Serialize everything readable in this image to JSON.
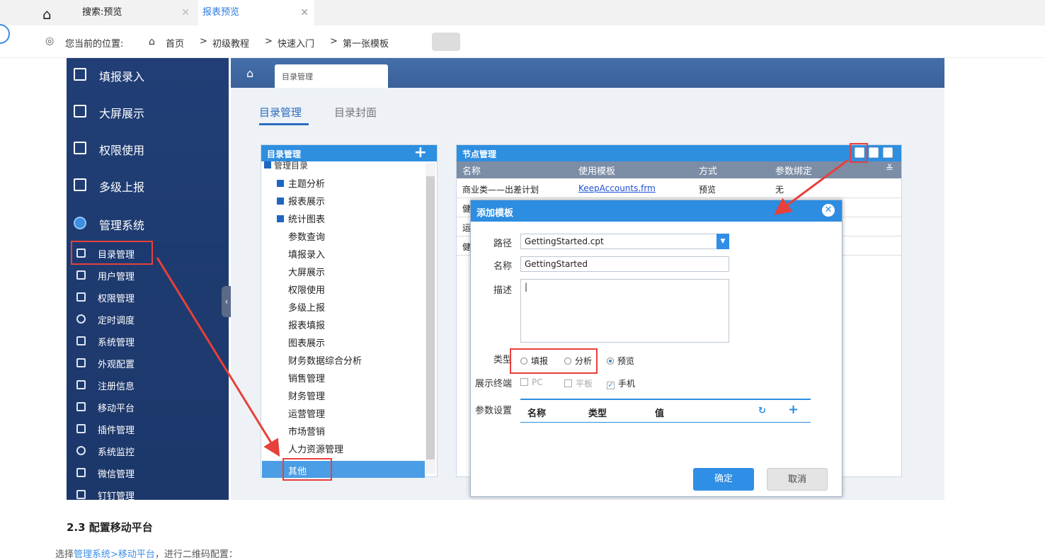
{
  "tabs": {
    "home_icon": "home-icon",
    "tab1_label": "搜索:预览",
    "tab2_label": "报表预览",
    "close": "✕"
  },
  "breadcrumb": {
    "prefix": "您当前的位置:",
    "items": [
      "首页",
      "初级教程",
      "快速入门",
      "第一张模板"
    ],
    "separator": ">"
  },
  "sidebar": {
    "big_items": [
      "填报录入",
      "大屏展示",
      "权限使用",
      "多级上报",
      "管理系统"
    ],
    "small_items": [
      "目录管理",
      "用户管理",
      "权限管理",
      "定时调度",
      "系统管理",
      "外观配置",
      "注册信息",
      "移动平台",
      "插件管理",
      "系统监控",
      "微信管理",
      "钉钉管理"
    ]
  },
  "main": {
    "top_tab": "目录管理",
    "sub_tabs": [
      "目录管理",
      "目录封面"
    ]
  },
  "directory_panel": {
    "title": "目录管理",
    "root": "管理目录",
    "folders": [
      "主题分析",
      "报表展示",
      "统计图表"
    ],
    "items": [
      "参数查询",
      "填报录入",
      "大屏展示",
      "权限使用",
      "多级上报",
      "报表填报",
      "图表展示",
      "财务数据综合分析",
      "销售管理",
      "财务管理",
      "运营管理",
      "市场营销",
      "人力资源管理",
      "其他"
    ]
  },
  "node_panel": {
    "title": "节点管理",
    "columns": [
      "名称",
      "使用模板",
      "方式",
      "参数绑定"
    ],
    "rows": [
      {
        "name": "商业类——出差计划",
        "template": "KeepAccounts.frm",
        "mode": "预览",
        "binding": "无"
      },
      {
        "name": "健",
        "template": "",
        "mode": "",
        "binding": ""
      },
      {
        "name": "运",
        "template": "",
        "mode": "",
        "binding": ""
      },
      {
        "name": "健",
        "template": "",
        "mode": "",
        "binding": ""
      }
    ]
  },
  "dialog": {
    "title": "添加模板",
    "path_label": "路径",
    "path_value": "GettingStarted.cpt",
    "name_label": "名称",
    "name_value": "GettingStarted",
    "desc_label": "描述",
    "type_label": "类型",
    "type_options": [
      "填报",
      "分析",
      "预览"
    ],
    "type_selected": "预览",
    "terminal_label": "展示终端",
    "terminals": [
      "PC",
      "平板",
      "手机"
    ],
    "terminal_checked": [
      "手机"
    ],
    "param_label": "参数设置",
    "param_columns": [
      "名称",
      "类型",
      "值"
    ],
    "ok": "确定",
    "cancel": "取消"
  },
  "article": {
    "heading": "2.3 配置移动平台",
    "body_prefix": "选择",
    "body_link": "管理系统>移动平台",
    "body_suffix": "，进行二维码配置："
  },
  "colors": {
    "accent": "#2d8de0",
    "sidebar": "#213f76",
    "highlight": "#e8403a"
  }
}
